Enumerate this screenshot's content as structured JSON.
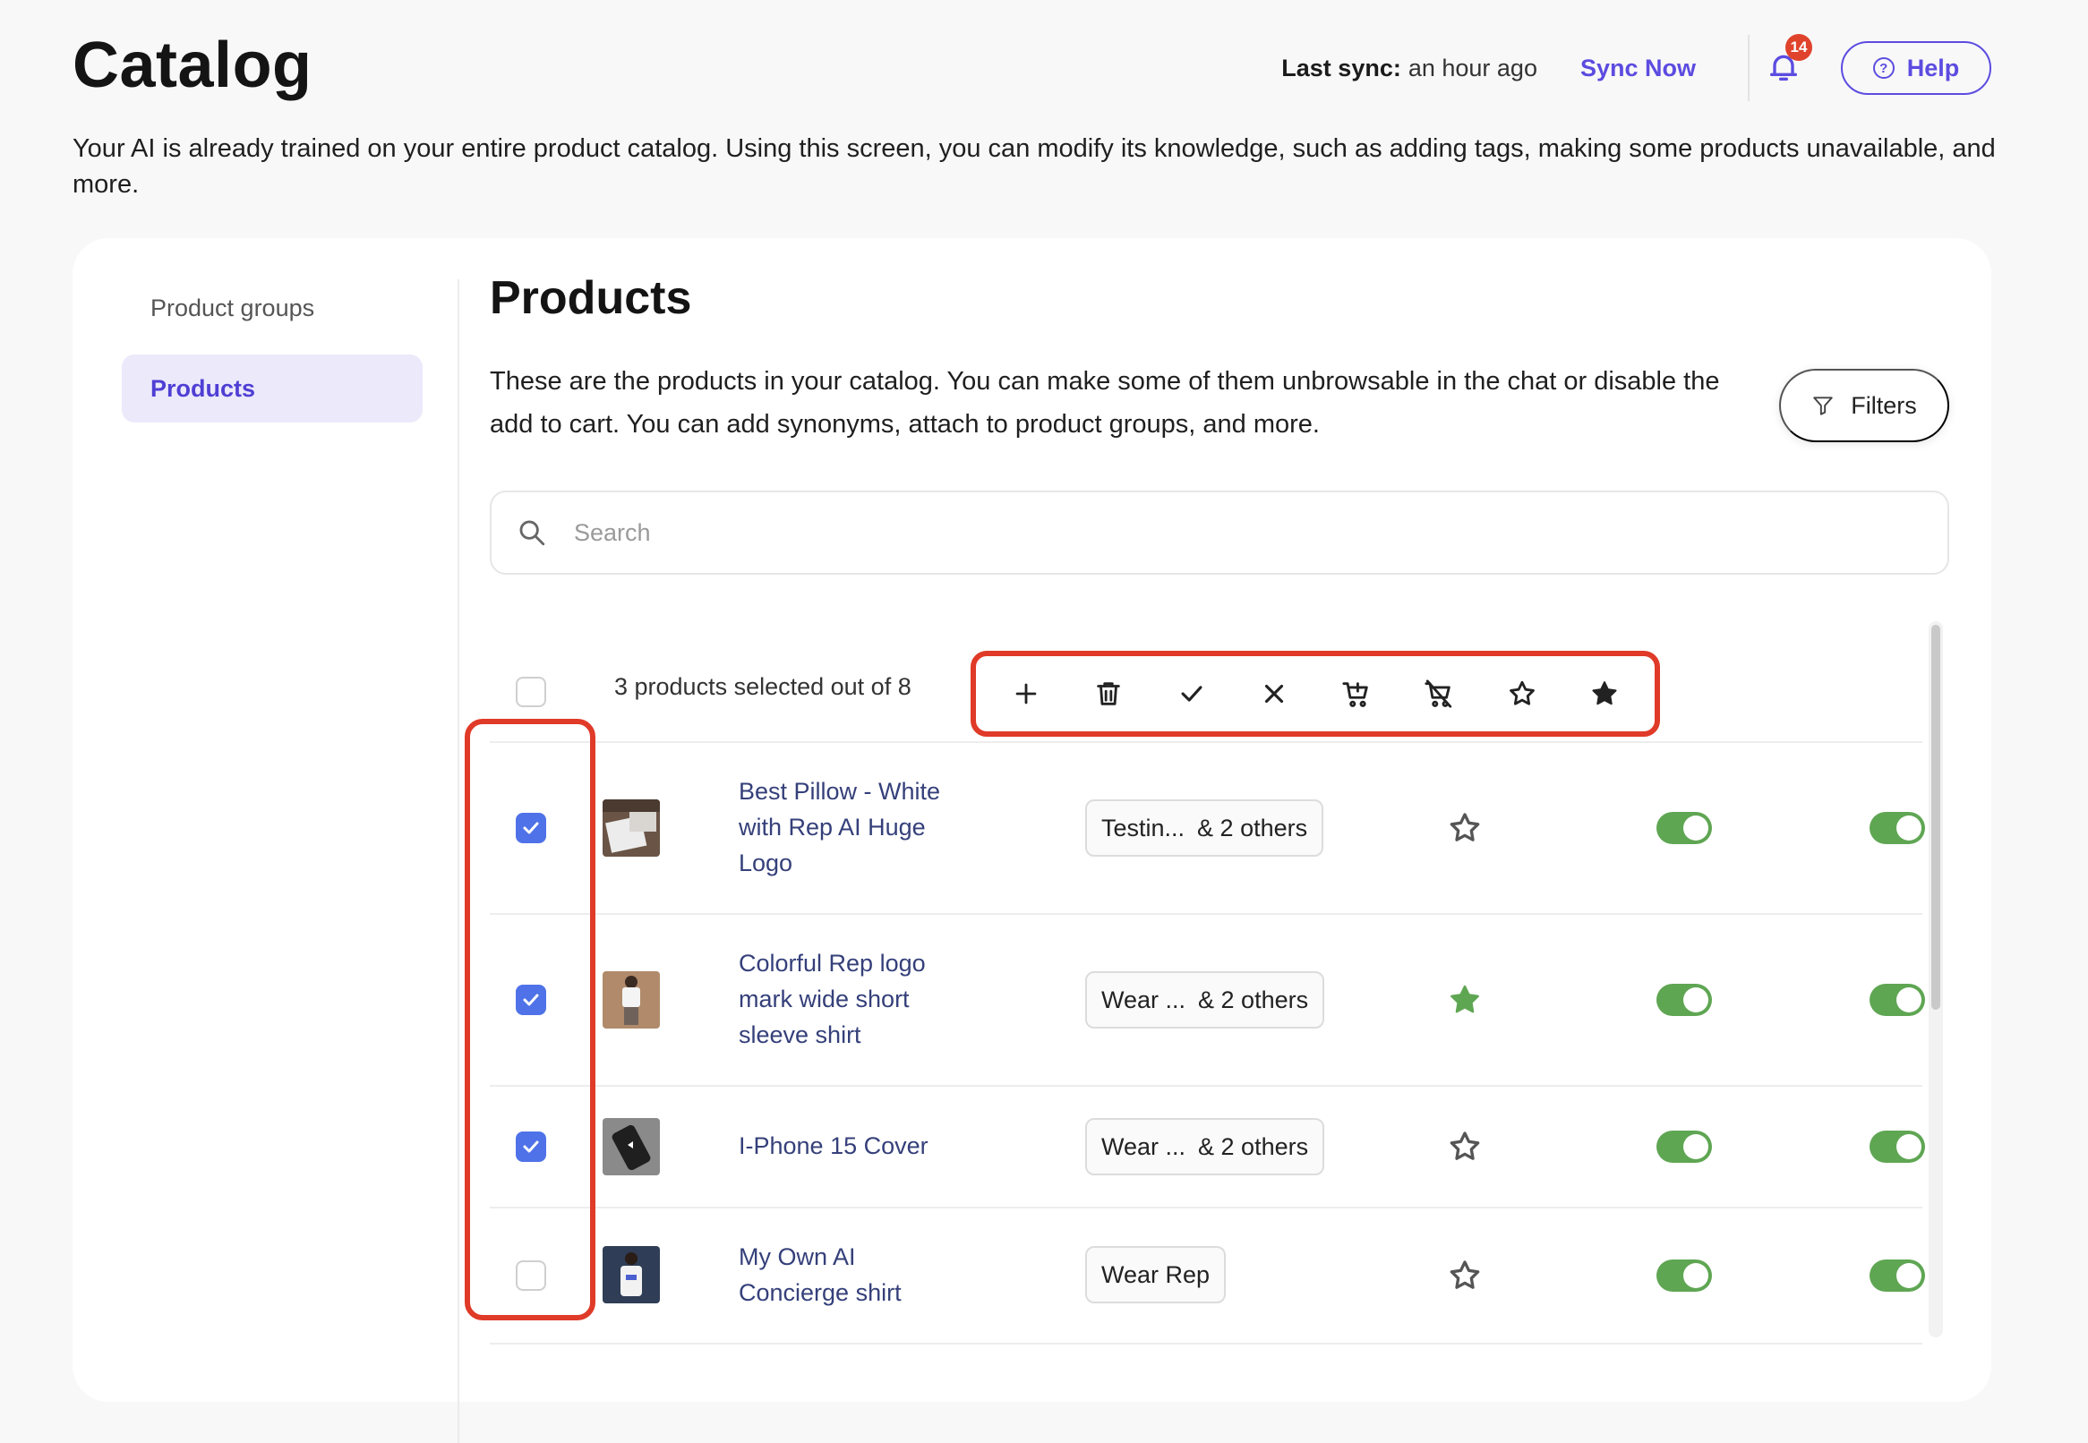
{
  "header": {
    "title": "Catalog",
    "last_sync_label": "Last sync:",
    "last_sync_value": "an hour ago",
    "sync_now": "Sync Now",
    "notification_count": "14",
    "help": "Help"
  },
  "intro": "Your AI is already trained on your entire product catalog. Using this screen, you can modify its knowledge, such as adding tags, making some products unavailable, and more.",
  "sidebar": {
    "items": [
      {
        "label": "Product groups",
        "active": false
      },
      {
        "label": "Products",
        "active": true
      }
    ]
  },
  "main": {
    "title": "Products",
    "description": "These are the products in your catalog. You can make some of them unbrowsable in the chat or disable the add to cart. You can add synonyms, attach to product groups, and more.",
    "filters": "Filters",
    "search_placeholder": "Search",
    "selection_text": "3 products selected out of 8",
    "actions": [
      "add-icon",
      "trash-icon",
      "check-icon",
      "close-icon",
      "cart-add-icon",
      "cart-remove-icon",
      "star-outline-icon",
      "star-filled-icon"
    ]
  },
  "products": [
    {
      "name": "Best Pillow - White with Rep AI Huge Logo",
      "checked": true,
      "tag": "Testin...",
      "tag_more": "& 2 others",
      "starred": false,
      "toggle1": true,
      "toggle2": true
    },
    {
      "name": "Colorful Rep logo mark wide short sleeve shirt",
      "checked": true,
      "tag": "Wear ...",
      "tag_more": "& 2 others",
      "starred": true,
      "toggle1": true,
      "toggle2": true
    },
    {
      "name": "I-Phone 15 Cover",
      "checked": true,
      "tag": "Wear ...",
      "tag_more": "& 2 others",
      "starred": false,
      "toggle1": true,
      "toggle2": true
    },
    {
      "name": "My Own AI Concierge shirt",
      "checked": false,
      "tag": "Wear Rep",
      "tag_more": "",
      "starred": false,
      "toggle1": true,
      "toggle2": true
    }
  ],
  "colors": {
    "accent": "#5c4ce0",
    "checkbox": "#4f72e8",
    "toggle_on": "#5fa653",
    "star_filled": "#5fa653",
    "highlight": "#e03a28",
    "badge": "#e0432b"
  }
}
